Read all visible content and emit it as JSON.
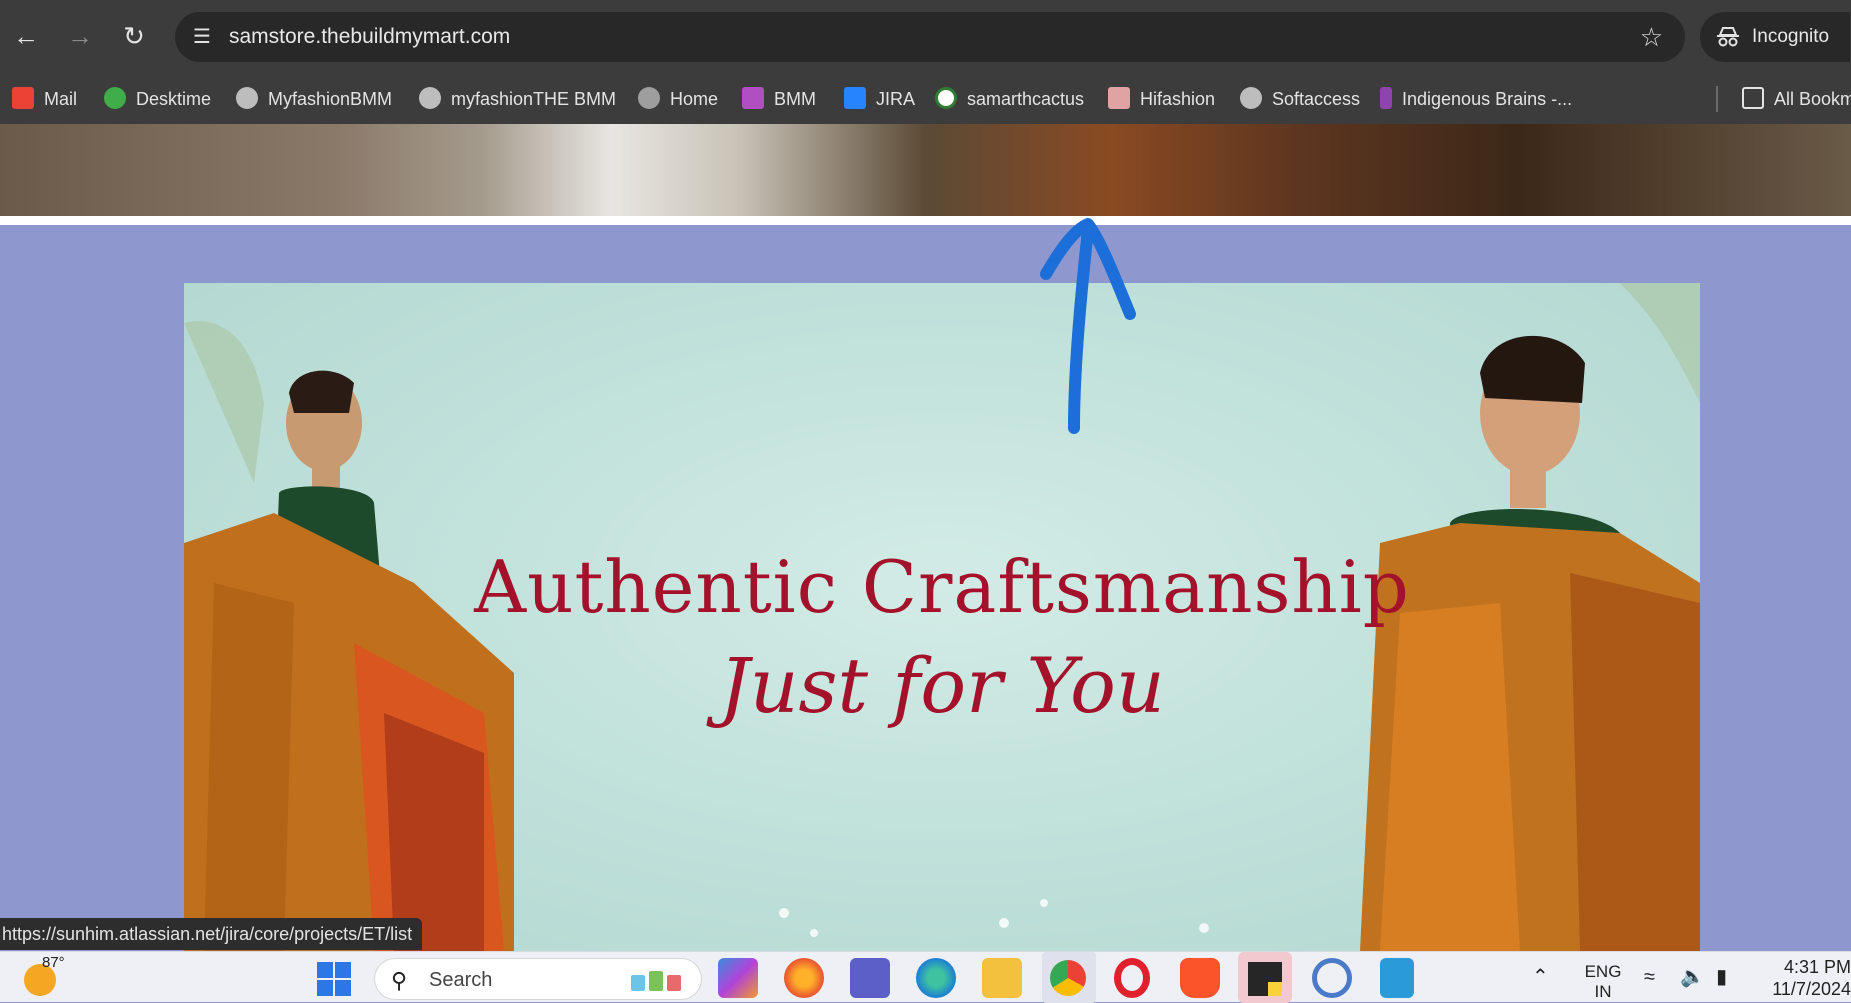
{
  "browser": {
    "url": "samstore.thebuildmymart.com",
    "profile_label": "Incognito",
    "bookmarks": [
      {
        "label": "Mail",
        "icon": "gmail-icon",
        "color": "#ea4335"
      },
      {
        "label": "Desktime",
        "icon": "desktime-icon",
        "color": "#3fae49"
      },
      {
        "label": "MyfashionBMM",
        "icon": "globe-icon",
        "color": "#bdbdbd"
      },
      {
        "label": "myfashionTHE BMM",
        "icon": "globe-icon",
        "color": "#bdbdbd"
      },
      {
        "label": "Home",
        "icon": "globe-icon",
        "color": "#9e9e9e"
      },
      {
        "label": "BMM",
        "icon": "bmm-icon",
        "color": "#b04fc0"
      },
      {
        "label": "JIRA",
        "icon": "jira-icon",
        "color": "#2684ff"
      },
      {
        "label": "samarthcactus",
        "icon": "cactus-icon",
        "color": "#2e7d32"
      },
      {
        "label": "Hifashion",
        "icon": "hifashion-icon",
        "color": "#e0a3a3"
      },
      {
        "label": "Softaccess",
        "icon": "globe-icon",
        "color": "#bdbdbd"
      },
      {
        "label": "Indigenous Brains -...",
        "icon": "indigenous-icon",
        "color": "#8e44ad"
      },
      {
        "label": "All Bookm",
        "icon": "folder-icon",
        "color": "#e3e3e3"
      }
    ]
  },
  "banner": {
    "line1": "Authentic Craftsmanship",
    "line2": "Just for You"
  },
  "status_bar": {
    "hover_url": "https://sunhim.atlassian.net/jira/core/projects/ET/list"
  },
  "taskbar": {
    "weather_temp": "87°",
    "search_label": "Search",
    "language_top": "ENG",
    "language_bottom": "IN",
    "time": "4:31 PM",
    "date": "11/7/2024"
  },
  "colors": {
    "page_bg": "#8e97ce",
    "banner_text": "#a3122a",
    "annotation_arrow": "#1c6fd8"
  }
}
